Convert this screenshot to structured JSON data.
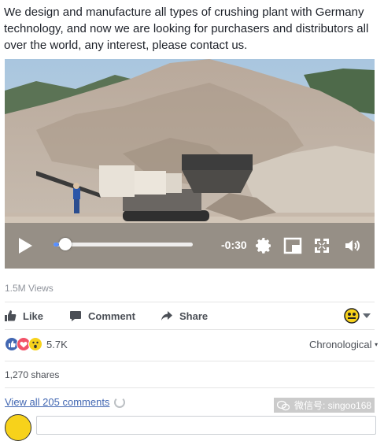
{
  "post": {
    "text": "We design and manufacture all types of crushing plant with Germany technology, and now we are looking for purchasers and distributors all over the world, any interest, please contact us."
  },
  "video": {
    "time_remaining": "-0:30",
    "progress": 0.04,
    "controls": [
      "play-icon",
      "settings-icon",
      "pip-icon",
      "fullscreen-icon",
      "volume-icon"
    ]
  },
  "stats": {
    "views": "1.5M Views"
  },
  "actions": {
    "like": "Like",
    "comment": "Comment",
    "share": "Share"
  },
  "reactions": {
    "icons": [
      "like-icon",
      "love-icon",
      "wow-icon"
    ],
    "count": "5.7K",
    "sort": "Chronological"
  },
  "shares": "1,270 shares",
  "comments": {
    "view_all": "View all 205 comments"
  },
  "watermark": {
    "text": "微信号: singoo168"
  },
  "colors": {
    "fb_blue": "#4267b2",
    "scrub_blue": "#5890ff",
    "love_red": "#f25268",
    "wow_yellow": "#f7d21b"
  }
}
